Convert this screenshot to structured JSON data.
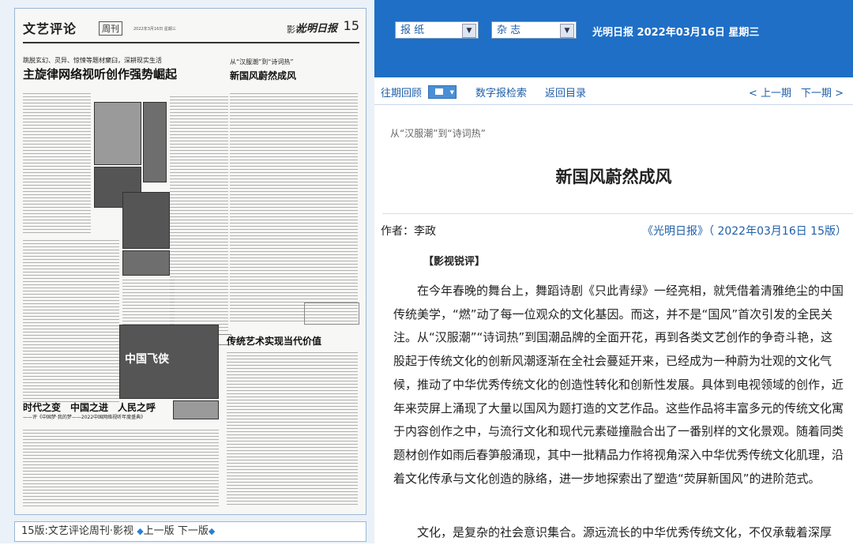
{
  "paper_thumbnail": {
    "column_title": "文艺评论",
    "column_sub": "周刊",
    "masthead_info": "2022年3月16日 星期三",
    "section": "影视",
    "logo": "光明日报",
    "page_number": "15",
    "lead_kicker": "跳脱玄幻、灵异、惊悚等题材窠臼，深耕现实生活",
    "lead_headline": "主旋律网络视听创作强势崛起",
    "mid_kicker": "从“汉服潮”到“诗词热”",
    "mid_headline": "新国风蔚然成风",
    "lower_headline": "传统艺术实现当代价值",
    "bottom_headline": "时代之变　中国之进　人民之呼",
    "bottom_sub": "——评《中国梦·我的梦——2022中国网络视听年度盛典》",
    "photo_caption": "中国飞侠"
  },
  "page_nav": {
    "label": "15版:文艺评论周刊·影视",
    "prev": "上一版",
    "next": "下一版"
  },
  "topbar": {
    "select1": "报 纸",
    "select2": "杂 志",
    "date_line": "光明日报 2022年03月16日 星期三"
  },
  "nav": {
    "archive": "往期回顾",
    "search": "数字报检索",
    "back": "返回目录",
    "prev_issue": "< 上一期",
    "next_issue": "下一期 >"
  },
  "article": {
    "kicker": "从“汉服潮”到“诗词热”",
    "title": "新国风蔚然成风",
    "author": "作者：李政",
    "source": "《光明日报》（ 2022年03月16日 15版）",
    "section": "【影视锐评】",
    "p1": "在今年春晚的舞台上，舞蹈诗剧《只此青绿》一经亮相，就凭借着清雅绝尘的中国传统美学，“燃”动了每一位观众的文化基因。而这，并不是“国风”首次引发的全民关注。从“汉服潮”“诗词热”到国潮品牌的全面开花，再到各类文艺创作的争奇斗艳，这股起于传统文化的创新风潮逐渐在全社会蔓延开来，已经成为一种蔚为壮观的文化气候，推动了中华优秀传统文化的创造性转化和创新性发展。具体到电视领域的创作，近年来荧屏上涌现了大量以国风为题打造的文艺作品。这些作品将丰富多元的传统文化寓于内容创作之中，与流行文化和现代元素碰撞融合出了一番别样的文化景观。随着同类题材创作如雨后春笋般涌现，其中一批精品力作将视角深入中华优秀传统文化肌理，沿着文化传承与文化创造的脉络，进一步地探索出了塑造“荧屏新国风”的进阶范式。",
    "p2": "文化，是复杂的社会意识集合。源远流长的中华优秀传统文化，不仅承载着深厚"
  },
  "colors": {
    "topbar_bg": "#1f6fc6",
    "link": "#1f5fa8",
    "accent_diamond": "#2d7fd1"
  }
}
